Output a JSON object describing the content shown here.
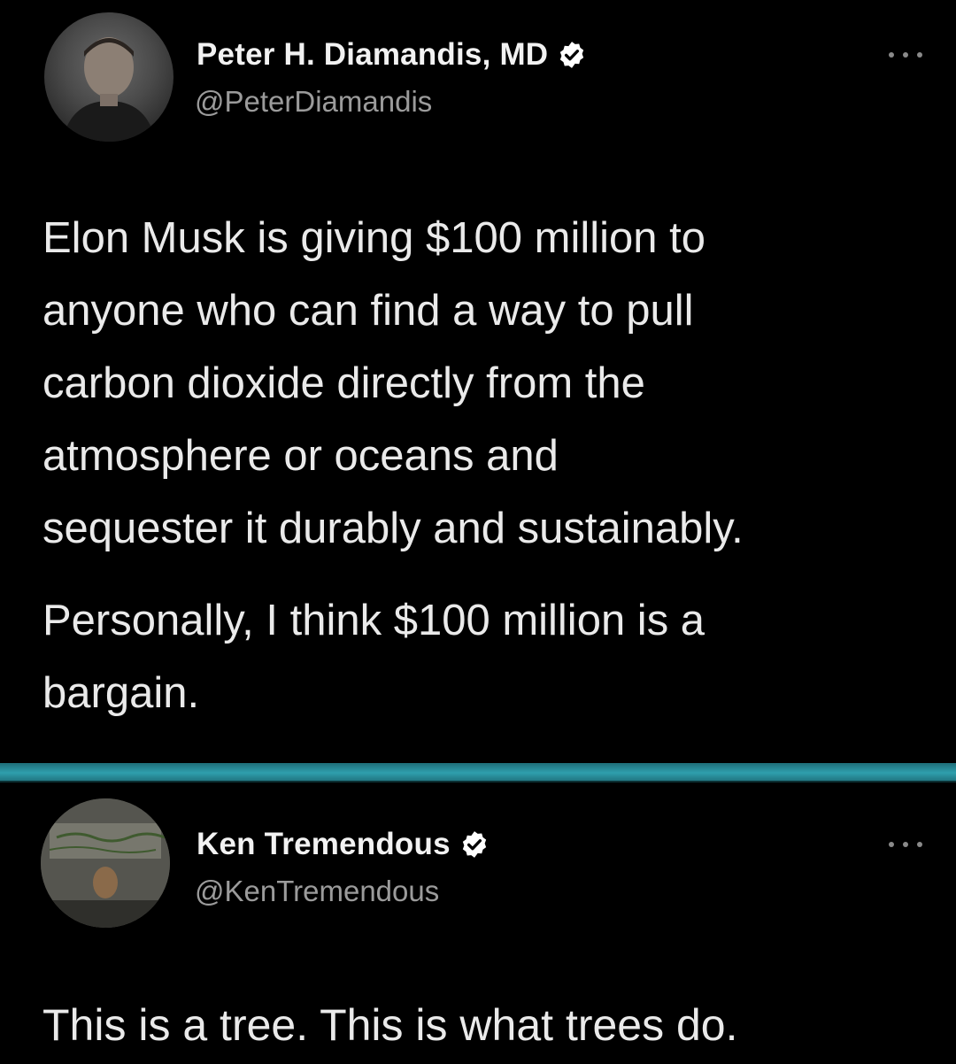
{
  "tweets": [
    {
      "author": {
        "display_name": "Peter H. Diamandis, MD",
        "handle": "@PeterDiamandis",
        "verified": true,
        "avatar_icon": "user-avatar-photo"
      },
      "paragraphs": [
        [
          "Elon Musk is giving $100 million to",
          "anyone who can find a way to pull",
          "carbon dioxide directly from the",
          "atmosphere or oceans and",
          "sequester it durably and sustainably."
        ],
        [
          "Personally, I think $100 million is a",
          "bargain."
        ]
      ],
      "menu_icon": "more-options-icon"
    },
    {
      "author": {
        "display_name": "Ken Tremendous",
        "handle": "@KenTremendous",
        "verified": true,
        "avatar_icon": "user-avatar-photo"
      },
      "paragraphs": [
        [
          "This is a tree. This is what trees do."
        ]
      ],
      "menu_icon": "more-options-icon"
    }
  ],
  "colors": {
    "background": "#000000",
    "divider": "#2f9fad",
    "text": "#eaeaea",
    "handle": "#9b9b9b",
    "verified_badge": "#ffffff"
  }
}
